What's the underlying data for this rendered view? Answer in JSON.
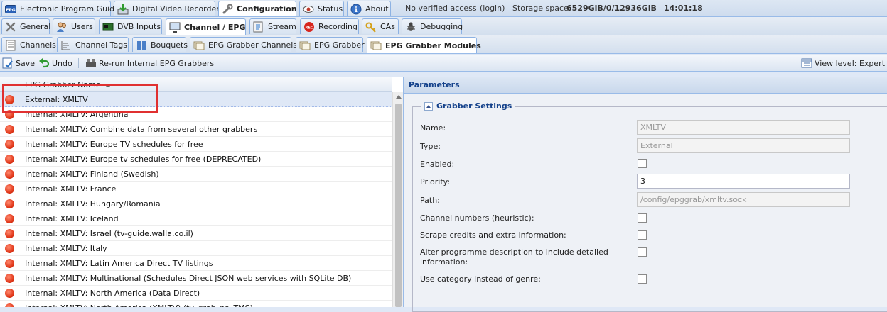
{
  "top_tabs": [
    {
      "label": "Electronic Program Guide"
    },
    {
      "label": "Digital Video Recorder"
    },
    {
      "label": "Configuration"
    },
    {
      "label": "Status"
    },
    {
      "label": "About"
    }
  ],
  "status": {
    "access": "No verified access",
    "login": "(login)",
    "storage_label": "Storage space:",
    "storage_value": "6529GiB/0/12936GiB",
    "time": "14:01:18"
  },
  "config_tabs": [
    {
      "label": "General"
    },
    {
      "label": "Users"
    },
    {
      "label": "DVB Inputs"
    },
    {
      "label": "Channel / EPG"
    },
    {
      "label": "Stream"
    },
    {
      "label": "Recording"
    },
    {
      "label": "CAs"
    },
    {
      "label": "Debugging"
    }
  ],
  "epg_tabs": [
    {
      "label": "Channels"
    },
    {
      "label": "Channel Tags"
    },
    {
      "label": "Bouquets"
    },
    {
      "label": "EPG Grabber Channels"
    },
    {
      "label": "EPG Grabber"
    },
    {
      "label": "EPG Grabber Modules"
    }
  ],
  "toolbar": {
    "save": "Save",
    "undo": "Undo",
    "rerun": "Re-run Internal EPG Grabbers",
    "view_level": "View level: Expert"
  },
  "grid": {
    "column": "EPG Grabber Name",
    "rows": [
      "External: XMLTV",
      "Internal: XMLTV: Argentina",
      "Internal: XMLTV: Combine data from several other grabbers",
      "Internal: XMLTV: Europe TV schedules for free",
      "Internal: XMLTV: Europe tv schedules for free (DEPRECATED)",
      "Internal: XMLTV: Finland (Swedish)",
      "Internal: XMLTV: France",
      "Internal: XMLTV: Hungary/Romania",
      "Internal: XMLTV: Iceland",
      "Internal: XMLTV: Israel (tv-guide.walla.co.il)",
      "Internal: XMLTV: Italy",
      "Internal: XMLTV: Latin America Direct TV listings",
      "Internal: XMLTV: Multinational (Schedules Direct JSON web services with SQLite DB)",
      "Internal: XMLTV: North America (Data Direct)",
      "Internal: XMLTV: North America (XMLTV) (tv_grab_na_TMS)"
    ]
  },
  "params": {
    "title": "Parameters",
    "section": "Grabber Settings",
    "name_label": "Name:",
    "name_value": "XMLTV",
    "type_label": "Type:",
    "type_value": "External",
    "enabled_label": "Enabled:",
    "priority_label": "Priority:",
    "priority_value": "3",
    "path_label": "Path:",
    "path_value": "/config/epggrab/xmltv.sock",
    "chnum_label": "Channel numbers (heuristic):",
    "scrape_label": "Scrape credits and extra information:",
    "alter_label_1": "Alter programme description to include detailed",
    "alter_label_2": "information:",
    "category_label": "Use category instead of genre:"
  }
}
